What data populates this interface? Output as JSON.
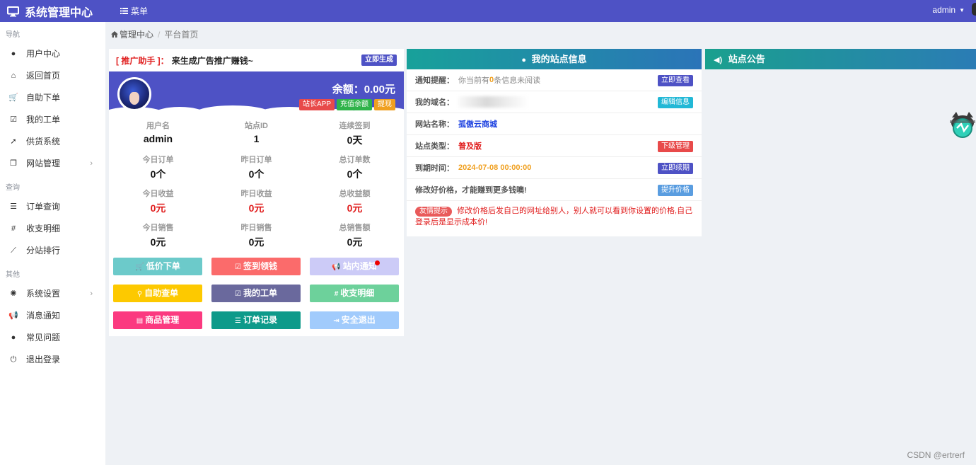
{
  "topbar": {
    "brand_title": "系统管理中心",
    "menu_label": "菜单",
    "user_name": "admin",
    "accent_color": "#4e52c5"
  },
  "sidebar": {
    "sections": [
      {
        "title": "导航",
        "items": [
          {
            "label": "用户中心",
            "icon": "user-icon"
          },
          {
            "label": "返回首页",
            "icon": "home-icon"
          },
          {
            "label": "自助下单",
            "icon": "cart-icon"
          },
          {
            "label": "我的工单",
            "icon": "checkbox-icon"
          },
          {
            "label": "供货系统",
            "icon": "rocket-icon"
          },
          {
            "label": "网站管理",
            "icon": "cube-icon",
            "has_submenu": true
          }
        ]
      },
      {
        "title": "查询",
        "items": [
          {
            "label": "订单查询",
            "icon": "list-icon"
          },
          {
            "label": "收支明细",
            "icon": "hash-icon"
          },
          {
            "label": "分站排行",
            "icon": "line-chart-icon"
          }
        ]
      },
      {
        "title": "其他",
        "items": [
          {
            "label": "系统设置",
            "icon": "rebel-icon",
            "has_submenu": true
          },
          {
            "label": "消息通知",
            "icon": "bullhorn-icon"
          },
          {
            "label": "常见问题",
            "icon": "info-icon"
          },
          {
            "label": "退出登录",
            "icon": "power-icon"
          }
        ]
      }
    ]
  },
  "breadcrumb": {
    "root": "管理中心",
    "current": "平台首页"
  },
  "promo": {
    "tag": "[ 推广助手 ]",
    "colon": "：",
    "text": "来生成广告推广赚钱~",
    "button": "立即生成"
  },
  "profile": {
    "balance": "余额：0.00元",
    "buttons": [
      {
        "label": "站长APP",
        "color": "#e84a4a"
      },
      {
        "label": "充值余额",
        "color": "#2fb34a"
      },
      {
        "label": "提现",
        "color": "#f0a020"
      }
    ]
  },
  "stats": [
    {
      "label": "用户名",
      "value": "admin",
      "highlight": false
    },
    {
      "label": "站点ID",
      "value": "1",
      "highlight": false
    },
    {
      "label": "连续签到",
      "value": "0天",
      "highlight": false
    },
    {
      "label": "今日订单",
      "value": "0个",
      "highlight": false
    },
    {
      "label": "昨日订单",
      "value": "0个",
      "highlight": false
    },
    {
      "label": "总订单数",
      "value": "0个",
      "highlight": false
    },
    {
      "label": "今日收益",
      "value": "0元",
      "highlight": true
    },
    {
      "label": "昨日收益",
      "value": "0元",
      "highlight": true
    },
    {
      "label": "总收益额",
      "value": "0元",
      "highlight": true
    },
    {
      "label": "今日销售",
      "value": "0元",
      "highlight": false
    },
    {
      "label": "昨日销售",
      "value": "0元",
      "highlight": false
    },
    {
      "label": "总销售额",
      "value": "0元",
      "highlight": false
    }
  ],
  "quick_actions": [
    {
      "label": "低价下单",
      "icon": "cart-icon",
      "color": "#6ccaca"
    },
    {
      "label": "签到领钱",
      "icon": "checkbox-icon",
      "color": "#fb6b6b"
    },
    {
      "label": "站内通知",
      "icon": "bullhorn-icon",
      "color": "#cccbf7",
      "notification_dot": true
    },
    {
      "label": "自助查单",
      "icon": "search-icon",
      "color": "#fdc900"
    },
    {
      "label": "我的工单",
      "icon": "checkbox-icon",
      "color": "#6a699d"
    },
    {
      "label": "收支明细",
      "icon": "hash-icon",
      "color": "#6dd19b"
    },
    {
      "label": "商品管理",
      "icon": "card-icon",
      "color": "#fb3a80"
    },
    {
      "label": "订单记录",
      "icon": "list-icon",
      "color": "#0e9a8a"
    },
    {
      "label": "安全退出",
      "icon": "exit-icon",
      "color": "#a1cbfc"
    }
  ],
  "site_info": {
    "title": "我的站点信息",
    "notice": {
      "key": "通知提醒：",
      "prefix": "你当前有",
      "count": "0",
      "suffix": "条信息未阅读",
      "button": "立即查看",
      "button_color": "#4e52c5"
    },
    "domain": {
      "key": "我的域名：",
      "button": "编辑信息",
      "button_color": "#22b8d6"
    },
    "site_name": {
      "key": "网站名称：",
      "value": "孤傲云商城"
    },
    "site_type": {
      "key": "站点类型：",
      "value": "普及版",
      "button": "下级管理",
      "button_color": "#e84a4a"
    },
    "expire": {
      "key": "到期时间：",
      "value": "2024-07-08 00:00:00",
      "button": "立即续期",
      "button_color": "#4e52c5"
    },
    "price": {
      "key": "修改好价格，才能赚到更多钱噢!",
      "button": "提升价格",
      "button_color": "#5a9de0"
    },
    "warning": {
      "badge": "友情提示",
      "text": "修改价格后发自己的网址给别人，别人就可以看到你设置的价格,自己登录后是显示成本价!"
    }
  },
  "announcement": {
    "title": "站点公告"
  },
  "watermark": "CSDN @ertrerf"
}
